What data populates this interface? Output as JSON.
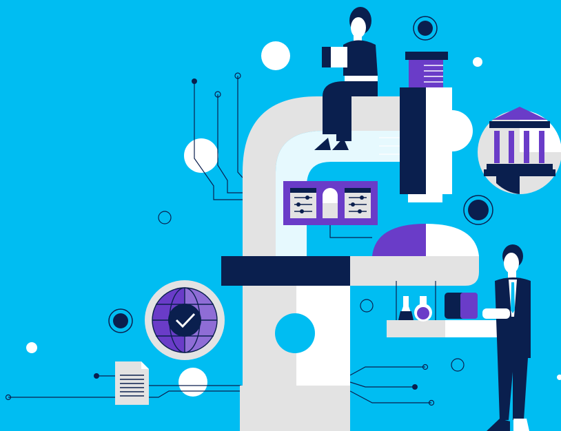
{
  "scene": {
    "background": "#00BDF2",
    "palette": {
      "navy": "#0A1F4E",
      "purple": "#6A3CC8",
      "light_gray": "#E3E3E3",
      "mid_gray": "#C8C8C8",
      "white": "#FFFFFF",
      "cyan": "#00BDF2",
      "skin": "#F2F2F2"
    },
    "icons": [
      "microscope-illustration",
      "woman-with-tablet",
      "man-in-suit-with-tablet",
      "bank-building-icon",
      "globe-checkmark-icon",
      "document-icon",
      "lab-flasks-icon",
      "capsule-icon",
      "slider-controls-icon",
      "circuit-lines"
    ]
  }
}
